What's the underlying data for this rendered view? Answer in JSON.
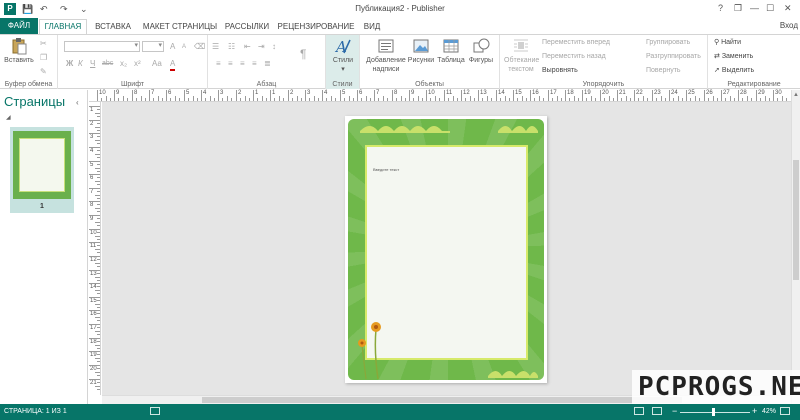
{
  "titlebar": {
    "title": "Публикация2 - Publisher",
    "app_icon": "P",
    "qat": {
      "save_icon": "💾",
      "undo_icon": "↶",
      "redo_icon": "↷",
      "customize_icon": "⌄"
    },
    "window": {
      "help": "?",
      "restore": "❐",
      "minimize": "—",
      "maximize": "☐",
      "close": "✕"
    }
  },
  "tabs": {
    "file": "ФАЙЛ",
    "items": [
      "ГЛАВНАЯ",
      "ВСТАВКА",
      "МАКЕТ СТРАНИЦЫ",
      "РАССЫЛКИ",
      "РЕЦЕНЗИРОВАНИЕ",
      "ВИД"
    ],
    "active_index": 0,
    "sign_in": "Вход"
  },
  "ribbon": {
    "clipboard": {
      "label": "Буфер обмена",
      "paste": "Вставить"
    },
    "font": {
      "label": "Шрифт",
      "bold": "Ж",
      "italic": "К",
      "underline": "Ч",
      "strike": "abc",
      "sub": "x₂",
      "sup": "x²",
      "size_up": "A",
      "size_down": "A",
      "color": "A"
    },
    "paragraph": {
      "label": "Абзац"
    },
    "styles": {
      "label": "Стили",
      "styles_btn": "Стили"
    },
    "objects": {
      "label": "Объекты",
      "text_box": "Добавление надписи",
      "pictures": "Рисунки",
      "table": "Таблица",
      "shapes": "Фигуры"
    },
    "arrange": {
      "label": "Упорядочить",
      "wrap_text": "Обтекание текстом",
      "bring_forward": "Переместить вперед",
      "send_backward": "Переместить назад",
      "align": "Выровнять",
      "group": "Группировать",
      "ungroup": "Разгруппировать",
      "rotate": "Повернуть"
    },
    "editing": {
      "label": "Редактирование",
      "find": "Найти",
      "replace": "Заменить",
      "select": "Выделить"
    }
  },
  "pages_panel": {
    "title": "Страницы",
    "collapse_icon": "‹",
    "page_number": "1"
  },
  "ruler": {
    "h_labels": [
      "10",
      "9",
      "8",
      "7",
      "6",
      "5",
      "4",
      "3",
      "2",
      "1",
      "1",
      "2",
      "3",
      "4",
      "5",
      "6",
      "7",
      "8",
      "9",
      "10",
      "11",
      "12",
      "13",
      "14",
      "15",
      "16",
      "17",
      "18",
      "19",
      "20",
      "21",
      "22",
      "23",
      "24",
      "25",
      "26",
      "27",
      "28",
      "29",
      "30"
    ],
    "v_labels": [
      "1",
      "2",
      "3",
      "4",
      "5",
      "6",
      "7",
      "8",
      "9",
      "10",
      "11",
      "12",
      "13",
      "14",
      "15",
      "16",
      "17",
      "18",
      "19",
      "20",
      "21"
    ]
  },
  "document": {
    "text_box_text": "Введите текст"
  },
  "status": {
    "page_info": "СТРАНИЦА: 1 ИЗ 1",
    "zoom": "42%",
    "zoom_minus": "−",
    "zoom_plus": "+"
  },
  "colors": {
    "accent": "#077568",
    "page_green": "#6fb84a",
    "lime": "#d6ea6a"
  },
  "watermark": "PCPROGS.NET"
}
